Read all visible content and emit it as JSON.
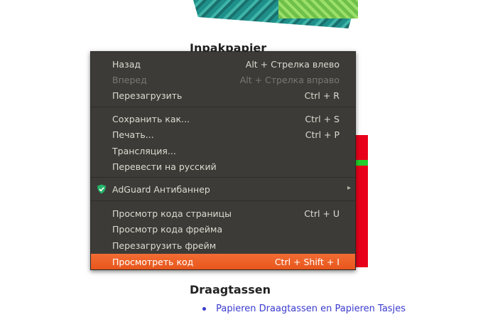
{
  "page": {
    "heading_inpak": "Inpakpapier",
    "heading_draag": "Draagtassen",
    "link": "Papieren Draagtassen en Papieren Tasjes"
  },
  "menu": {
    "items": [
      {
        "label": "Назад",
        "shortcut": "Alt + Стрелка влево"
      },
      {
        "label": "Вперед",
        "shortcut": "Alt + Стрелка вправо"
      },
      {
        "label": "Перезагрузить",
        "shortcut": "Ctrl + R"
      },
      {
        "label": "Сохранить как...",
        "shortcut": "Ctrl + S"
      },
      {
        "label": "Печать...",
        "shortcut": "Ctrl + P"
      },
      {
        "label": "Трансляция...",
        "shortcut": ""
      },
      {
        "label": "Перевести на русский",
        "shortcut": ""
      },
      {
        "label": "AdGuard Антибаннер",
        "shortcut": ""
      },
      {
        "label": "Просмотр кода страницы",
        "shortcut": "Ctrl + U"
      },
      {
        "label": "Просмотр кода фрейма",
        "shortcut": ""
      },
      {
        "label": "Перезагрузить фрейм",
        "shortcut": ""
      },
      {
        "label": "Просмотреть код",
        "shortcut": "Ctrl + Shift + I"
      }
    ],
    "icons": {
      "adguard": "adguard-shield-icon",
      "submenu": "chevron-right-icon"
    },
    "colors": {
      "background": "#3c3b37",
      "highlight": "#f26d34",
      "text": "#dfdbd2",
      "disabled": "#7b7872"
    }
  }
}
